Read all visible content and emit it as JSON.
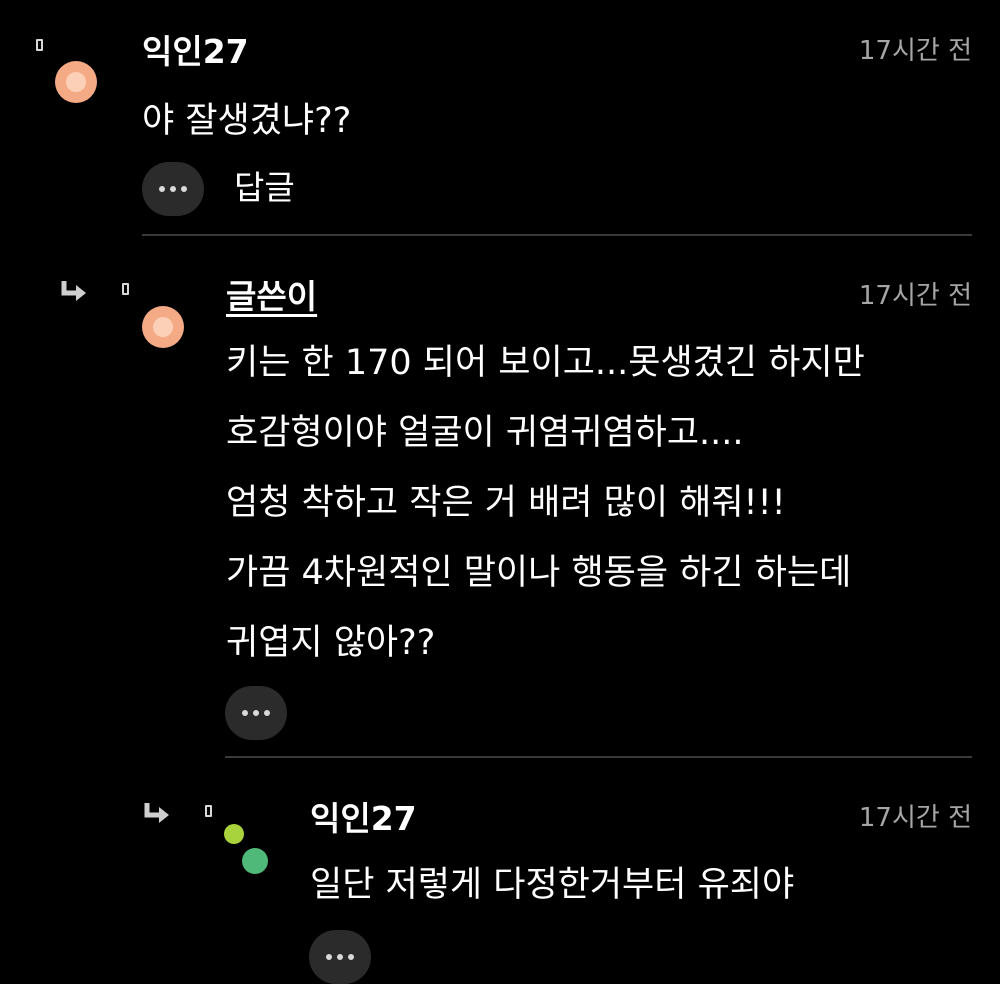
{
  "colors": {
    "background": "#000000",
    "text": "#ffffff",
    "time": "#a6a6a6",
    "button_bg": "#2b2b2b",
    "divider": "#3a3a3a",
    "avatar_peach": "#f4ab85",
    "avatar_lime": "#a8d33c",
    "avatar_green": "#4fb979"
  },
  "comments": [
    {
      "author": "익인27",
      "time": "17시간 전",
      "lines": [
        "야 잘생겼냐??"
      ],
      "reply_label": "답글",
      "device_icon": "mobile-icon",
      "avatar_icon": "peach-circle-avatar"
    },
    {
      "author": "글쓴이",
      "time": "17시간 전",
      "lines": [
        "키는 한 170 되어 보이고...못생겼긴 하지만",
        "호감형이야 얼굴이 귀염귀염하고....",
        "엄청 착하고 작은 거 배려 많이 해줘!!!",
        "가끔 4차원적인 말이나 행동을 하긴 하는데",
        "귀엽지 않아??"
      ],
      "device_icon": "mobile-icon",
      "reply_icon": "reply-arrow-icon",
      "avatar_icon": "peach-circle-avatar"
    },
    {
      "author": "익인27",
      "time": "17시간 전",
      "lines": [
        "일단 저렇게 다정한거부터 유죄야"
      ],
      "device_icon": "mobile-icon",
      "reply_icon": "reply-arrow-icon",
      "avatar_icon": "green-dots-avatar"
    }
  ],
  "more_icon": "more-dots-icon"
}
